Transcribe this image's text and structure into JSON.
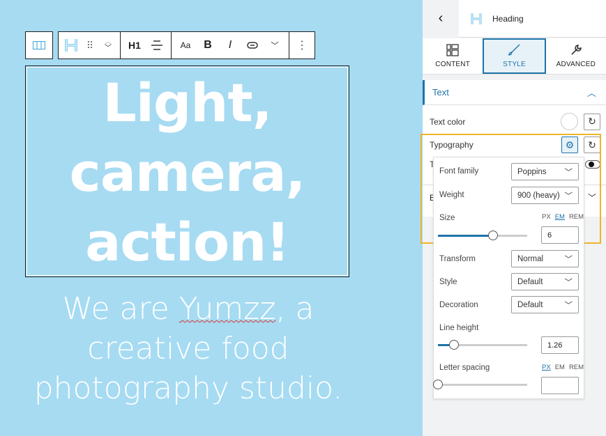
{
  "canvas": {
    "toolbar": {
      "transform_icon": "columns-icon",
      "block_icon": "heading-icon",
      "h_level": "H1",
      "items": [
        "drag-handle",
        "move-up-down",
        "align",
        "font-size",
        "bold",
        "italic",
        "link",
        "more-rich-text",
        "options"
      ]
    },
    "heading_lines": [
      "Light,",
      "camera,",
      "action!"
    ],
    "subtitle": {
      "pre": "We are ",
      "brand": "Yumzz",
      "post": ", a",
      "line2": "creative food",
      "line3": "photography studio."
    }
  },
  "panel": {
    "title": "Heading",
    "tabs": [
      {
        "label": "CONTENT"
      },
      {
        "label": "STYLE",
        "active": true
      },
      {
        "label": "ADVANCED"
      }
    ],
    "section": {
      "title": "Text",
      "rows": {
        "text_color": "Text color",
        "typography": "Typography",
        "hidden_row_1": "T",
        "hidden_row_2": "B"
      }
    },
    "typography": {
      "font_family": {
        "label": "Font family",
        "value": "Poppins"
      },
      "weight": {
        "label": "Weight",
        "value": "900 (heavy)"
      },
      "size": {
        "label": "Size",
        "units": [
          "PX",
          "EM",
          "REM"
        ],
        "active_unit": "EM",
        "value": "6",
        "slider_fraction": 0.62
      },
      "transform": {
        "label": "Transform",
        "value": "Normal"
      },
      "style": {
        "label": "Style",
        "value": "Default"
      },
      "decoration": {
        "label": "Decoration",
        "value": "Default"
      },
      "line_height": {
        "label": "Line height",
        "value": "1.26",
        "slider_fraction": 0.18
      },
      "letter_spacing": {
        "label": "Letter spacing",
        "units": [
          "PX",
          "EM",
          "REM"
        ],
        "active_unit": "PX",
        "value": "",
        "slider_fraction": 0
      }
    }
  },
  "colors": {
    "canvas_bg": "#a6dbf2",
    "accent": "#1e73a8",
    "highlight": "#f0b429"
  }
}
